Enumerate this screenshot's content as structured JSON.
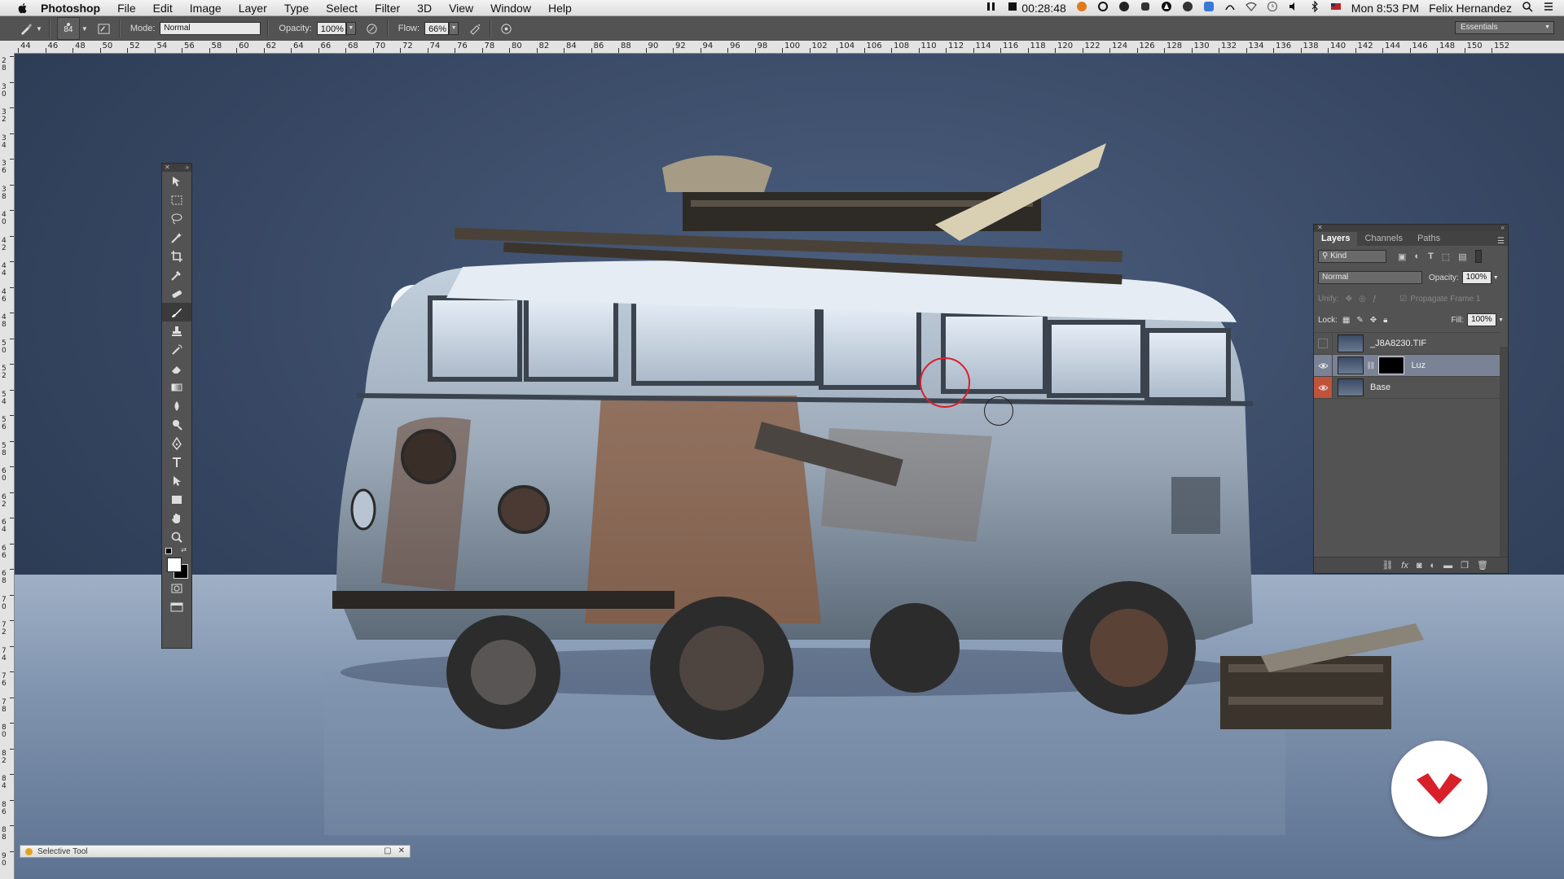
{
  "menubar": {
    "app": "Photoshop",
    "items": [
      "File",
      "Edit",
      "Image",
      "Layer",
      "Type",
      "Select",
      "Filter",
      "3D",
      "View",
      "Window",
      "Help"
    ],
    "timer": "00:28:48",
    "datetime": "Mon 8:53 PM",
    "user": "Felix Hernandez"
  },
  "options": {
    "brush_size": "84",
    "mode_label": "Mode:",
    "mode_value": "Normal",
    "opacity_label": "Opacity:",
    "opacity_value": "100%",
    "flow_label": "Flow:",
    "flow_value": "66%",
    "workspace": "Essentials"
  },
  "ruler": {
    "h_ticks": [
      "44",
      "46",
      "48",
      "50",
      "52",
      "54",
      "56",
      "58",
      "60",
      "62",
      "64",
      "66",
      "68",
      "70",
      "72",
      "74",
      "76",
      "78",
      "80",
      "82",
      "84",
      "86",
      "88",
      "90",
      "92",
      "94",
      "96",
      "98",
      "100",
      "102",
      "104",
      "106",
      "108",
      "110",
      "112",
      "114",
      "116",
      "118",
      "120",
      "122",
      "124",
      "126",
      "128",
      "130",
      "132",
      "134",
      "136",
      "138",
      "140",
      "142",
      "144",
      "146",
      "148",
      "150",
      "152"
    ],
    "v_ticks": [
      "28",
      "30",
      "32",
      "34",
      "36",
      "38",
      "40",
      "42",
      "44",
      "46",
      "48",
      "50",
      "52",
      "54",
      "56",
      "58",
      "60",
      "62",
      "64",
      "66",
      "68",
      "70",
      "72",
      "74",
      "76",
      "78",
      "80",
      "82",
      "84",
      "86",
      "88",
      "90"
    ]
  },
  "layers_panel": {
    "tabs": [
      "Layers",
      "Channels",
      "Paths"
    ],
    "kind": "Kind",
    "blend_mode": "Normal",
    "opacity_label": "Opacity:",
    "opacity_value": "100%",
    "unify_label": "Unify:",
    "propagate_label": "Propagate Frame 1",
    "lock_label": "Lock:",
    "fill_label": "Fill:",
    "fill_value": "100%",
    "layers": [
      {
        "name": "_J8A8230.TIF",
        "visible": false,
        "selected": false
      },
      {
        "name": "Luz",
        "visible": true,
        "selected": true
      },
      {
        "name": "Base",
        "visible": true,
        "selected": false
      }
    ]
  },
  "bottom_window": {
    "title": "Selective Tool"
  },
  "colors": {
    "accent_red": "#d8202a",
    "panel_bg": "#535353",
    "selected_layer": "#7a8296",
    "eye_active_bg": "#c0533a"
  }
}
